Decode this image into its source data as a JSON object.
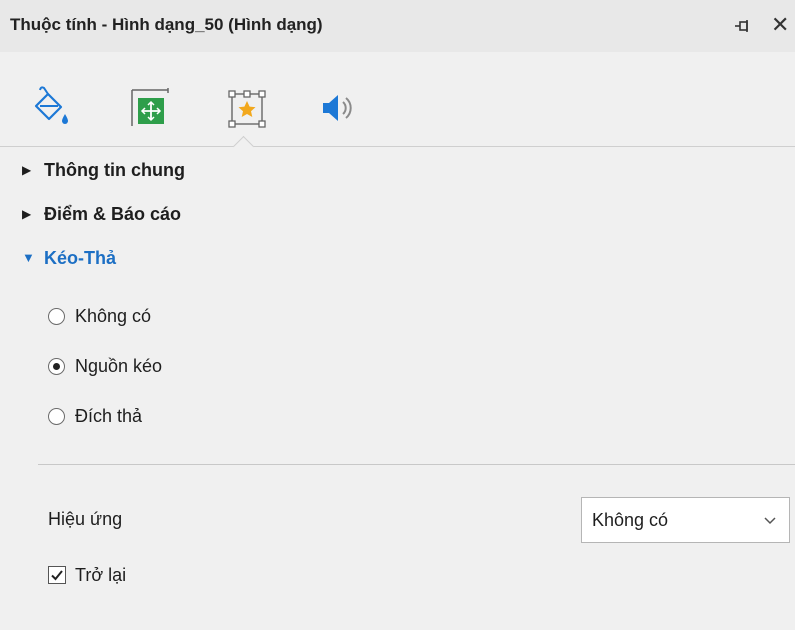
{
  "panel": {
    "title": "Thuộc tính - Hình dạng_50 (Hình dạng)",
    "close_glyph": "✕"
  },
  "tabs": [
    {
      "icon": "paint-bucket-icon"
    },
    {
      "icon": "size-position-icon"
    },
    {
      "icon": "interaction-star-icon",
      "selected": true
    },
    {
      "icon": "audio-speaker-icon"
    }
  ],
  "sections": {
    "general": "Thông tin chung",
    "score": "Điểm & Báo cáo",
    "drag_drop": "Kéo-Thả"
  },
  "drag_drop": {
    "options": [
      "Không có",
      "Nguồn kéo",
      "Đích thả"
    ],
    "selected": "Nguồn kéo",
    "effect_label": "Hiệu ứng",
    "effect_value": "Không có",
    "revert_label": "Trở lại",
    "revert_checked": true
  },
  "colors": {
    "accent": "#1c6fc4",
    "tab_blue": "#1c78d6",
    "tab_green": "#2e9e4a",
    "star_orange": "#f2a81d"
  }
}
